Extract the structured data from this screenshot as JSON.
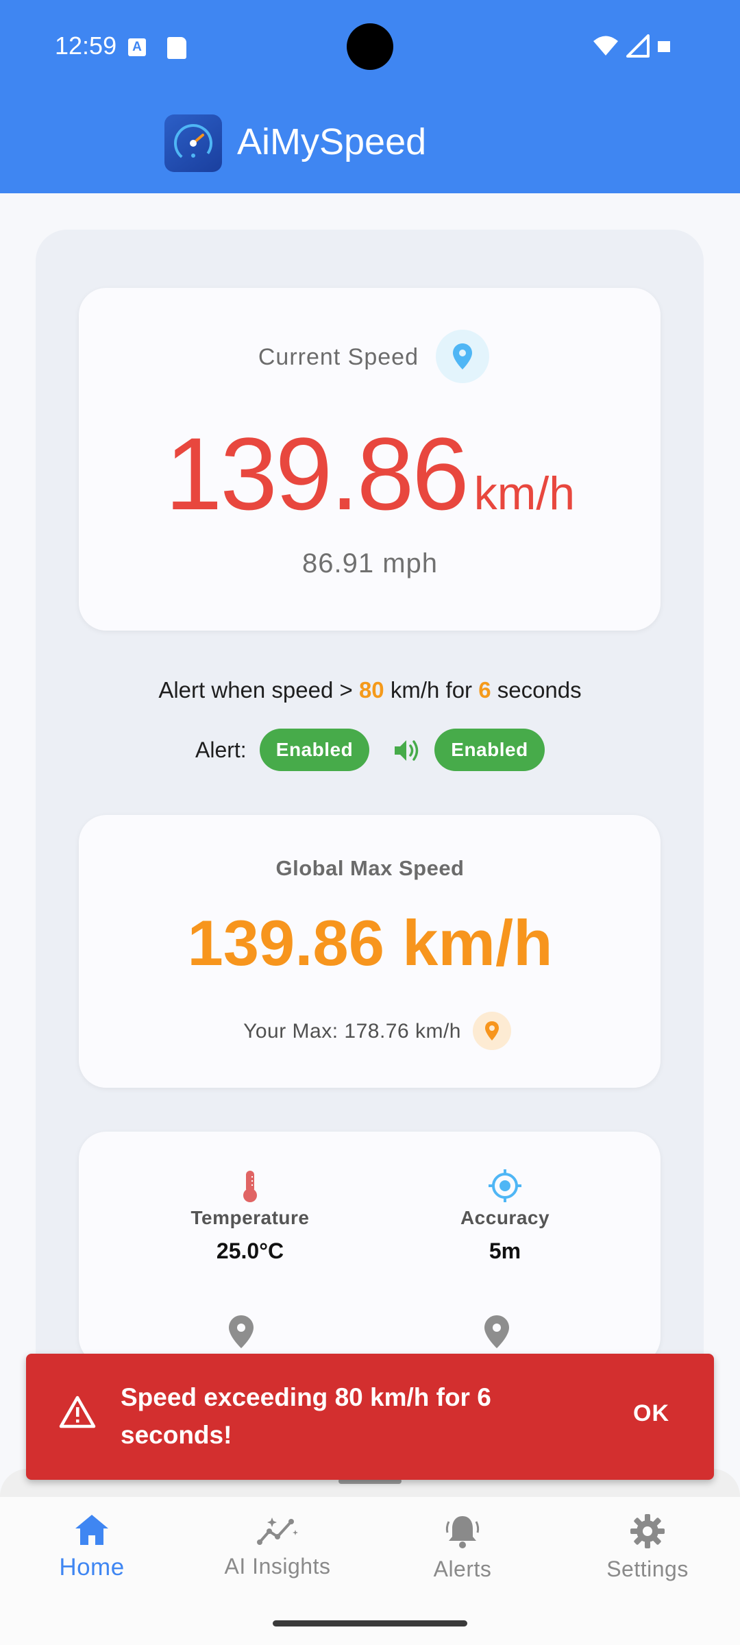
{
  "status_bar": {
    "time": "12:59",
    "notification_icons": [
      "a-icon",
      "sd-card-icon"
    ],
    "system_icons": [
      "wifi-icon",
      "signal-icon",
      "battery-icon"
    ]
  },
  "app_bar": {
    "title": "AiMySpeed",
    "logo": "speedometer-logo"
  },
  "current_speed": {
    "title": "Current Speed",
    "value": "139.86",
    "unit": "km/h",
    "mph": "86.91 mph"
  },
  "alert_settings": {
    "prefix": "Alert when speed > ",
    "threshold": "80",
    "middle": " km/h for ",
    "duration": "6",
    "suffix": " seconds",
    "alert_label": "Alert:",
    "alert_status": "Enabled",
    "sound_status": "Enabled"
  },
  "global_max": {
    "title": "Global Max Speed",
    "value": "139.86 km/h",
    "your_max": "Your Max: 178.76 km/h"
  },
  "info": {
    "temperature_label": "Temperature",
    "temperature_value": "25.0°C",
    "accuracy_label": "Accuracy",
    "accuracy_value": "5m"
  },
  "snackbar": {
    "message": "Speed exceeding 80 km/h for 6 seconds!",
    "action": "OK"
  },
  "nav": [
    {
      "label": "Home",
      "icon": "home-icon",
      "active": true
    },
    {
      "label": "AI Insights",
      "icon": "insights-icon",
      "active": false
    },
    {
      "label": "Alerts",
      "icon": "bell-icon",
      "active": false
    },
    {
      "label": "Settings",
      "icon": "gear-icon",
      "active": false
    }
  ],
  "colors": {
    "primary": "#3f86f2",
    "speed_red": "#e8473e",
    "max_orange": "#f7951d",
    "enabled_green": "#47ab4a",
    "snackbar_red": "#d32f2f"
  }
}
